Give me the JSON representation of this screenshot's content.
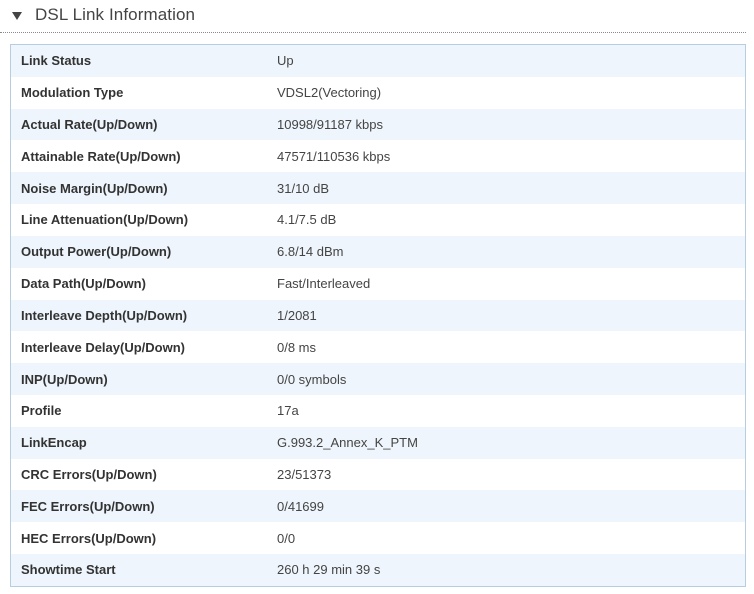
{
  "section": {
    "title": "DSL Link Information",
    "expanded": true,
    "toggle_icon": "triangle-down-icon"
  },
  "colors": {
    "row_stripe": "#eef5fc",
    "border": "#b9cde0",
    "text": "#333333"
  },
  "rows": [
    {
      "label": "Link Status",
      "value": "Up"
    },
    {
      "label": "Modulation Type",
      "value": "VDSL2(Vectoring)"
    },
    {
      "label": "Actual Rate(Up/Down)",
      "value": "10998/91187 kbps"
    },
    {
      "label": "Attainable Rate(Up/Down)",
      "value": "47571/110536 kbps"
    },
    {
      "label": "Noise Margin(Up/Down)",
      "value": "31/10 dB"
    },
    {
      "label": "Line Attenuation(Up/Down)",
      "value": "4.1/7.5 dB"
    },
    {
      "label": "Output Power(Up/Down)",
      "value": "6.8/14 dBm"
    },
    {
      "label": "Data Path(Up/Down)",
      "value": "Fast/Interleaved"
    },
    {
      "label": "Interleave Depth(Up/Down)",
      "value": "1/2081"
    },
    {
      "label": "Interleave Delay(Up/Down)",
      "value": "0/8 ms"
    },
    {
      "label": "INP(Up/Down)",
      "value": "0/0 symbols"
    },
    {
      "label": "Profile",
      "value": "17a"
    },
    {
      "label": "LinkEncap",
      "value": "G.993.2_Annex_K_PTM"
    },
    {
      "label": "CRC Errors(Up/Down)",
      "value": "23/51373"
    },
    {
      "label": "FEC Errors(Up/Down)",
      "value": "0/41699"
    },
    {
      "label": "HEC Errors(Up/Down)",
      "value": "0/0"
    },
    {
      "label": "Showtime Start",
      "value": "260 h 29 min 39 s"
    }
  ]
}
